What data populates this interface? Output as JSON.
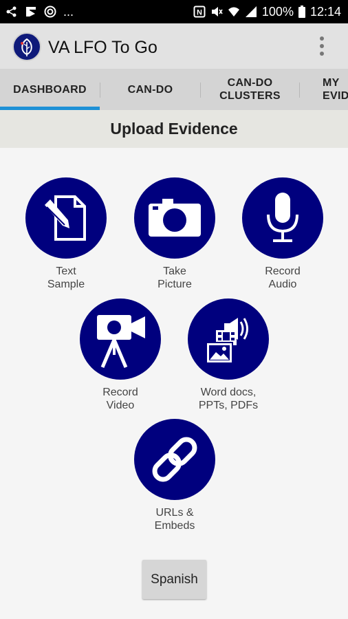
{
  "status_bar": {
    "left_icons": [
      "share-icon",
      "flipboard-icon",
      "target-icon"
    ],
    "more_text": "...",
    "battery": "100%",
    "time": "12:14",
    "right_icons": [
      "nfc-icon",
      "mute-icon",
      "wifi-icon",
      "signal-icon",
      "battery-icon"
    ]
  },
  "app_bar": {
    "title": "VA LFO To Go",
    "logo_icon": "leaf-logo-icon",
    "menu_icon": "overflow-menu-icon"
  },
  "tabs": [
    {
      "label": "DASHBOARD",
      "selected": true
    },
    {
      "label": "CAN-DO"
    },
    {
      "label": "CAN-DO CLUSTERS"
    },
    {
      "label": "MY EVID"
    }
  ],
  "section_title": "Upload Evidence",
  "actions": [
    {
      "label": "Text Sample",
      "icon": "text-sample-icon"
    },
    {
      "label": "Take Picture",
      "icon": "camera-icon"
    },
    {
      "label": "Record Audio",
      "icon": "microphone-icon"
    },
    {
      "label": "Record Video",
      "icon": "video-camera-icon"
    },
    {
      "label": "Word docs, PPTs, PDFs",
      "icon": "media-files-icon"
    },
    {
      "label": "URLs & Embeds",
      "icon": "link-icon"
    }
  ],
  "spanish_button": "Spanish",
  "colors": {
    "accent": "#00007e",
    "tab_indicator": "#1e90d6",
    "status_bar": "#000000",
    "app_bar": "#e2e2e2"
  }
}
